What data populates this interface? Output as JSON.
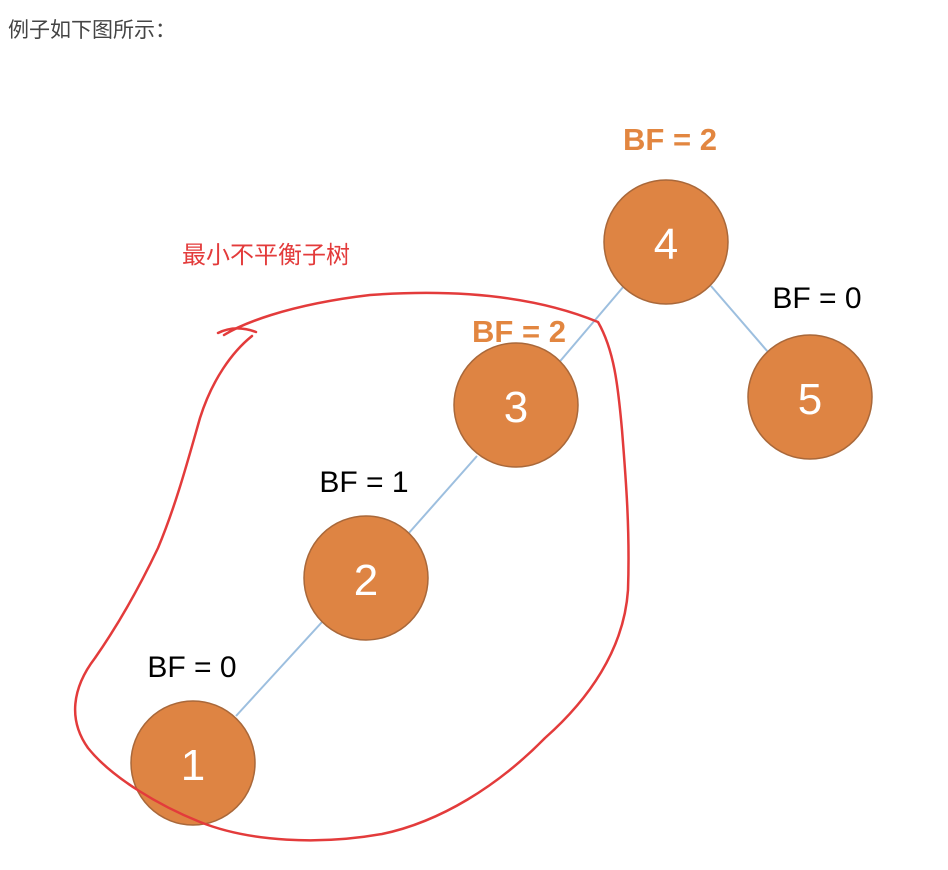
{
  "intro_text": "例子如下图所示：",
  "annotation": "最小不平衡子树",
  "colors": {
    "node_fill": "#de8443",
    "node_stroke": "#a9683a",
    "edge": "#9dbfdf",
    "highlight_bf": "#e28640",
    "annotation": "#e33b3b"
  },
  "nodes": [
    {
      "label": "4",
      "bf": "BF = 2",
      "bf_highlight": true
    },
    {
      "label": "5",
      "bf": "BF = 0",
      "bf_highlight": false
    },
    {
      "label": "3",
      "bf": "BF = 2",
      "bf_highlight": true
    },
    {
      "label": "2",
      "bf": "BF = 1",
      "bf_highlight": false
    },
    {
      "label": "1",
      "bf": "BF = 0",
      "bf_highlight": false
    }
  ],
  "edges": [
    {
      "from": "4",
      "to": "3"
    },
    {
      "from": "4",
      "to": "5"
    },
    {
      "from": "3",
      "to": "2"
    },
    {
      "from": "2",
      "to": "1"
    }
  ]
}
